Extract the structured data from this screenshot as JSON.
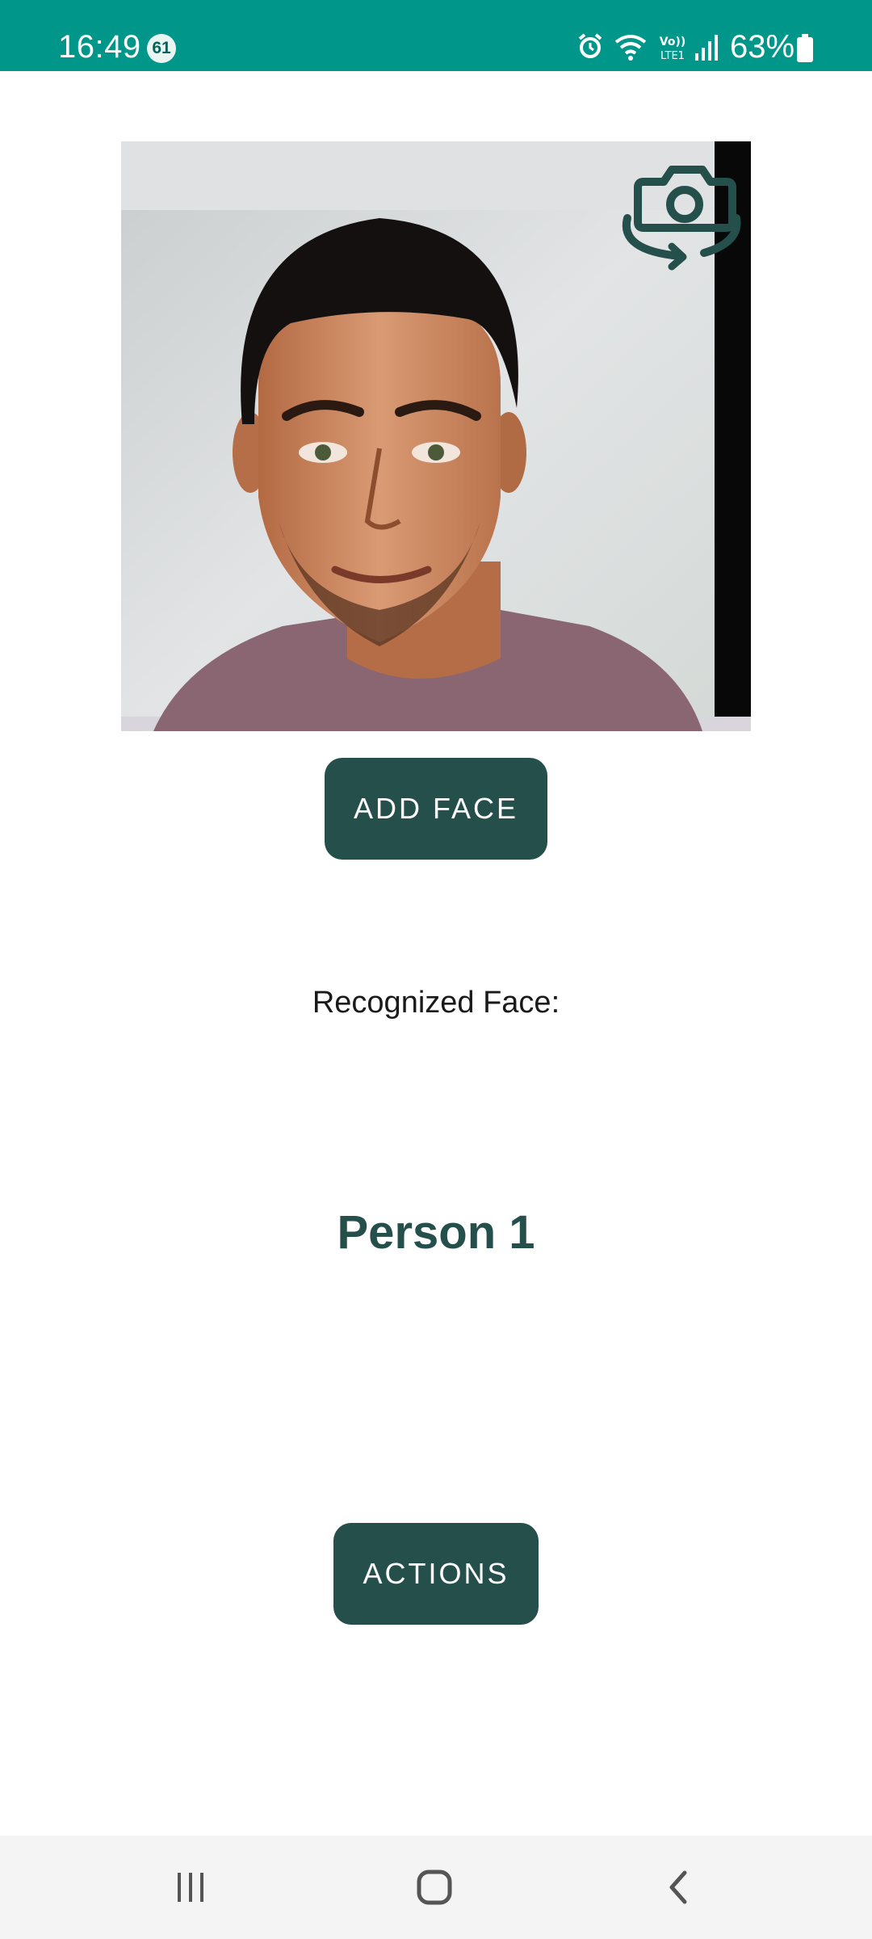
{
  "status_bar": {
    "time": "16:49",
    "notification_count": "61",
    "network_label": "Vo)) LTE1",
    "battery_percent": "63%",
    "icons": [
      "alarm-icon",
      "wifi-icon",
      "volte-icon",
      "signal-icon",
      "battery-icon"
    ]
  },
  "camera": {
    "switch_icon": "switch-camera-icon"
  },
  "buttons": {
    "add_face": "ADD FACE",
    "actions": "ACTIONS"
  },
  "recognition": {
    "label": "Recognized Face:",
    "name": "Person 1"
  },
  "nav_bar": {
    "icons": [
      "recent-apps-icon",
      "home-icon",
      "back-icon"
    ]
  },
  "colors": {
    "status_bar": "#00968a",
    "accent": "#254f4b",
    "nav_bar": "#f4f4f4"
  }
}
